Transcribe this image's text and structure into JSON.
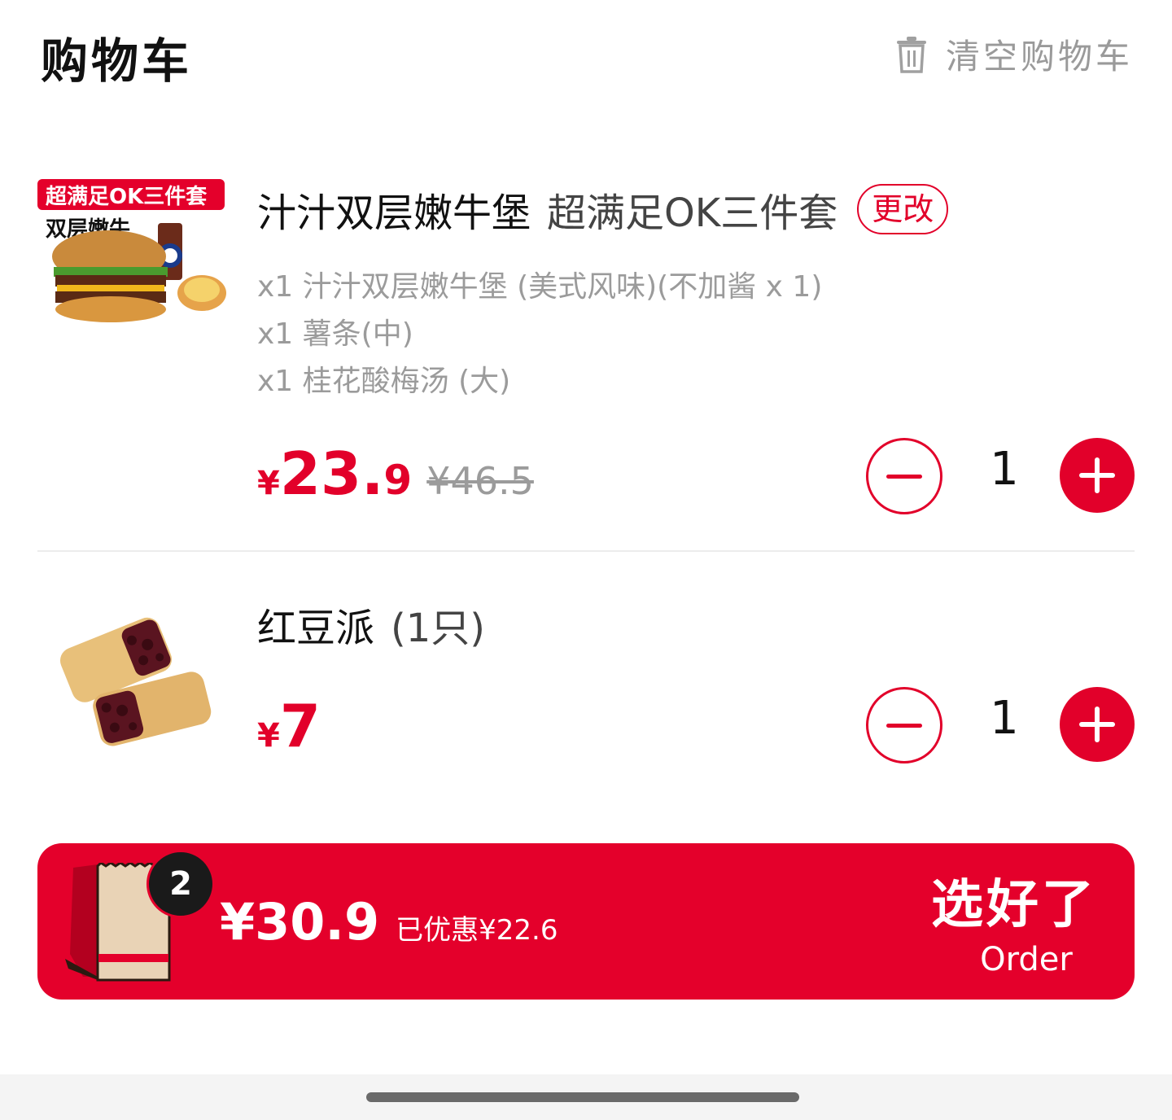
{
  "header": {
    "title": "购物车",
    "clear_label": "清空购物车"
  },
  "items": [
    {
      "thumb_banner": "超满足OK三件套",
      "thumb_title": "双层嫩牛",
      "name": "汁汁双层嫩牛堡",
      "sub": "超满足OK三件套",
      "change_label": "更改",
      "components": [
        "x1 汁汁双层嫩牛堡 (美式风味)(不加酱 x 1)",
        "x1 薯条(中)",
        "x1 桂花酸梅汤 (大)"
      ],
      "currency": "¥",
      "price_int": "23.",
      "price_dec": "9",
      "original_price": "¥46.5",
      "quantity": "1"
    },
    {
      "name": "红豆派",
      "sub": "(1只)",
      "currency": "¥",
      "price_int": "7",
      "price_dec": "",
      "quantity": "1"
    }
  ],
  "checkout": {
    "badge_count": "2",
    "total": "¥30.9",
    "saved": "已优惠¥22.6",
    "order_cn": "选好了",
    "order_en": "Order"
  },
  "colors": {
    "accent": "#e2002a",
    "muted": "#9b9b9b"
  }
}
